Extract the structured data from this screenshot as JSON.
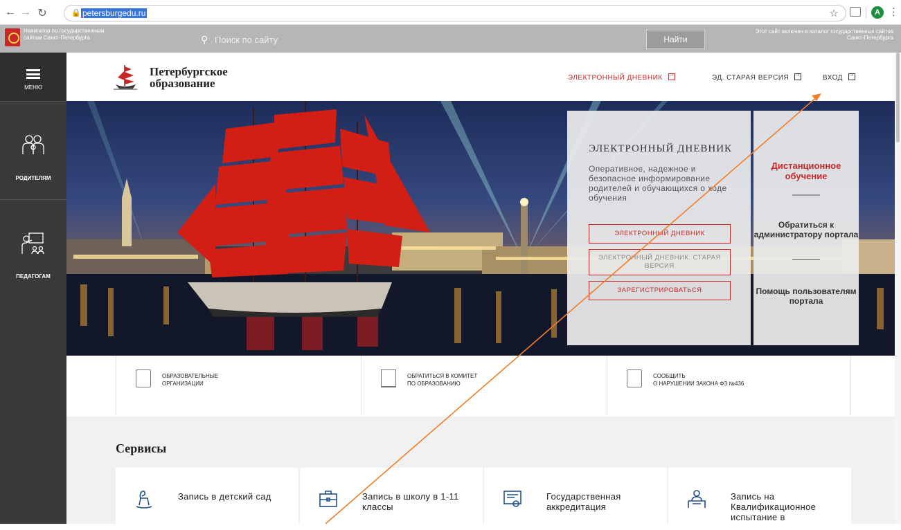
{
  "browser": {
    "url": "petersburgedu.ru",
    "avatar_letter": "A"
  },
  "govbar": {
    "navigator_text": "Навигатор по государственным сайтам Санкт-Петербурга",
    "search_placeholder": "Поиск по сайту",
    "find_button": "Найти",
    "catalog_text": "Этот сайт включен в каталог государственных сайтов Санкт-Петербурга"
  },
  "sidebar": {
    "menu_label": "МЕНЮ",
    "items": [
      {
        "label": "РОДИТЕЛЯМ"
      },
      {
        "label": "ПЕДАГОГАМ"
      }
    ]
  },
  "header": {
    "logo_line1": "Петербургское",
    "logo_line2": "образование",
    "links": [
      {
        "label": "ЭЛЕКТРОННЫЙ ДНЕВНИК"
      },
      {
        "label": "ЭД. СТАРАЯ ВЕРСИЯ"
      },
      {
        "label": "ВХОД"
      }
    ]
  },
  "hero": {
    "panel_title": "ЭЛЕКТРОННЫЙ ДНЕВНИК",
    "panel_desc": "Оперативное, надежное и безопасное информирование родителей и обучающихся о ходе обучения",
    "buttons": [
      {
        "label": "ЭЛЕКТРОННЫЙ ДНЕВНИК"
      },
      {
        "label": "ЭЛЕКТРОННЫЙ ДНЕВНИК. СТАРАЯ ВЕРСИЯ"
      },
      {
        "label": "ЗАРЕГИСТРИРОВАТЬСЯ"
      }
    ],
    "side_red": "Дистанционное обучение",
    "side_items": [
      {
        "label": "Обратиться к администратору портала"
      },
      {
        "label": "Помощь пользователям портала"
      }
    ]
  },
  "quick_links": [
    {
      "line1": "ОБРАЗОВАТЕЛЬНЫЕ",
      "line2": "ОРГАНИЗАЦИИ"
    },
    {
      "line1": "ОБРАТИТЬСЯ В КОМИТЕТ",
      "line2": "ПО ОБРАЗОВАНИЮ"
    },
    {
      "line1": "СООБЩИТЬ",
      "line2": "О НАРУШЕНИИ ЗАКОНА ФЗ №436"
    }
  ],
  "services": {
    "title": "Сервисы",
    "items": [
      {
        "label": "Запись в детский сад"
      },
      {
        "label": "Запись в школу в 1-11 классы"
      },
      {
        "label": "Государственная аккредитация"
      },
      {
        "label": "Запись на Квалификационное испытание в"
      }
    ]
  },
  "colors": {
    "accent_red": "#c62828",
    "sidebar_dark": "#3a3a3a",
    "annotation_arrow": "#ef7d2a"
  }
}
